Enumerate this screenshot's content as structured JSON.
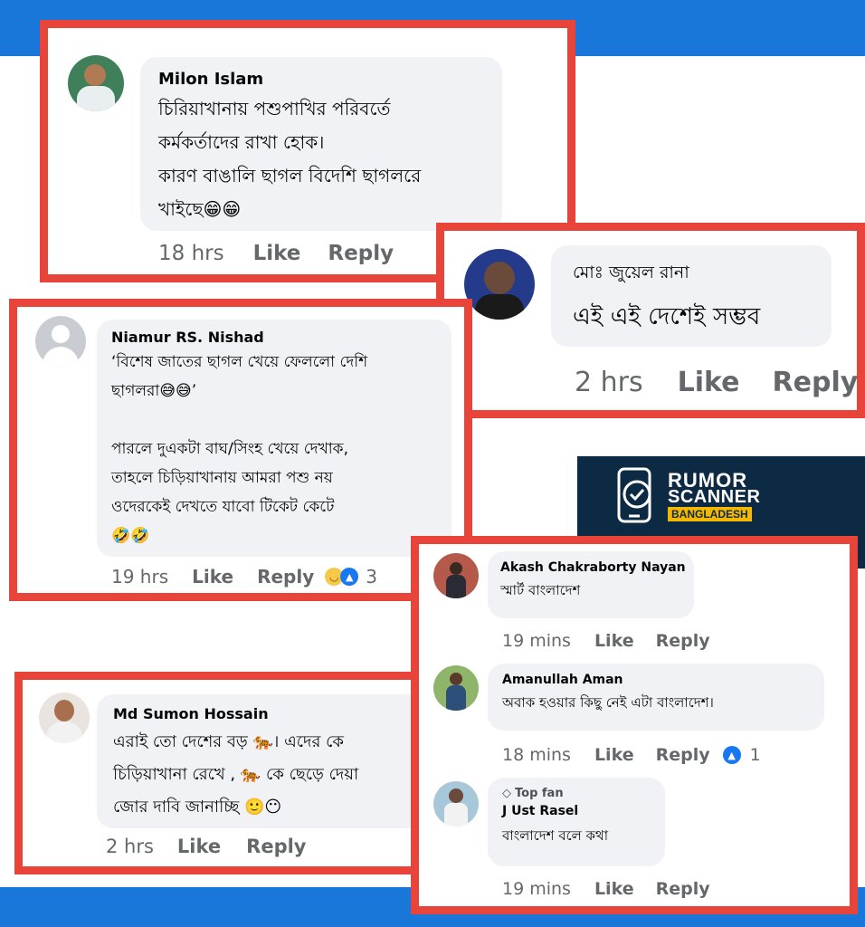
{
  "colors": {
    "brand_blue": "#1877d8",
    "frame_red": "#e8443a",
    "bubble_gray": "#f0f2f5",
    "meta_gray": "#65676b",
    "like_blue": "#1877f2"
  },
  "comments": {
    "milon": {
      "author": "Milon Islam",
      "lines": [
        "চিরিয়াখানায় পশুপাখির পরিবর্তে",
        "কর্মকর্তাদের রাখা হোক।",
        "কারণ বাঙালি ছাগল বিদেশি ছাগলরে",
        "খাইছে😁😁"
      ],
      "time": "18 hrs",
      "like": "Like",
      "reply": "Reply"
    },
    "juel": {
      "author": "মোঃ জুয়েল রানা",
      "lines": [
        "এই এই দেশেই সম্ভব"
      ],
      "time": "2 hrs",
      "like": "Like",
      "reply": "Reply"
    },
    "niamur": {
      "author": "Niamur RS. Nishad",
      "lines": [
        "‘বিশেষ জাতের ছাগল খেয়ে ফেললো দেশি",
        "ছাগলরা😅😅’",
        "",
        "পারলে দুএকটা বাঘ/সিংহ খেয়ে দেখাক,",
        "তাহলে চিড়িয়াখানায় আমরা পশু নয়",
        "ওদেরকেই দেখতে যাবো টিকেট কেটে",
        "🤣🤣"
      ],
      "time": "19 hrs",
      "like": "Like",
      "reply": "Reply",
      "reactions": "3"
    },
    "sumon": {
      "author": "Md Sumon Hossain",
      "lines": [
        "এরাই তো দেশের বড় 🐅। এদের কে",
        "চিড়িয়াখানা রেখে , 🐅 কে ছেড়ে দেয়া",
        "জোর দাবি জানাচ্ছি 🙂😶"
      ],
      "time": "2 hrs",
      "like": "Like",
      "reply": "Reply"
    },
    "akash": {
      "author": "Akash Chakraborty Nayan",
      "lines": [
        "স্মার্ট বাংলাদেশ"
      ],
      "time": "19 mins",
      "like": "Like",
      "reply": "Reply"
    },
    "amanullah": {
      "author": "Amanullah Aman",
      "lines": [
        "অবাক হওয়ার কিছু নেই এটা বাংলাদেশ।"
      ],
      "time": "18 mins",
      "like": "Like",
      "reply": "Reply",
      "reactions": "1"
    },
    "rasel": {
      "badge": "Top fan",
      "author": "J Ust Rasel",
      "lines": [
        "বাংলাদেশ বলে কথা"
      ],
      "time": "19 mins",
      "like": "Like",
      "reply": "Reply"
    }
  },
  "logo": {
    "line1": "RUMOR",
    "line2": "SCANNER",
    "line3": "BANGLADESH"
  },
  "icons": [
    "default-avatar-icon",
    "like-reaction-icon",
    "haha-reaction-icon",
    "top-fan-diamond-icon",
    "phone-check-logo-icon"
  ]
}
